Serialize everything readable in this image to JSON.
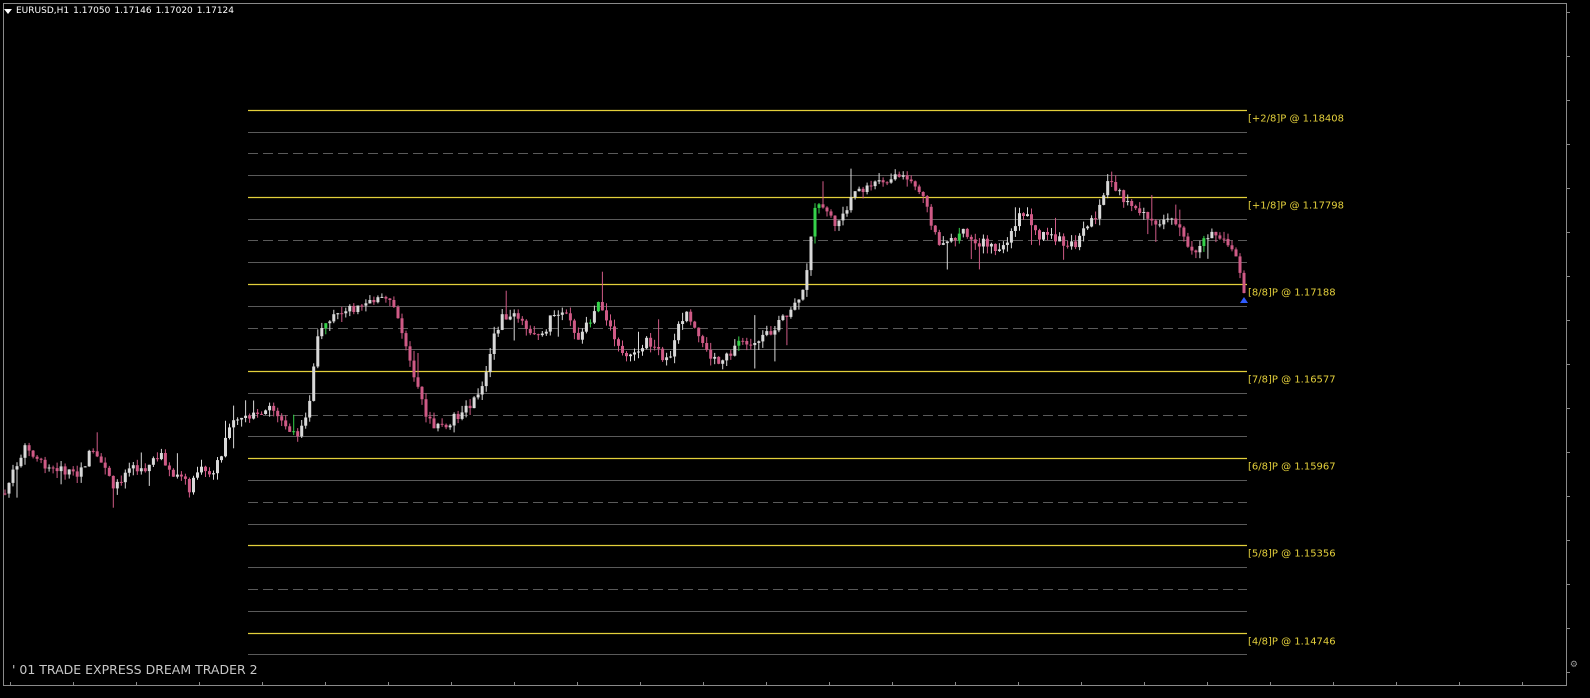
{
  "header": {
    "symbol": "EURUSD,H1",
    "open": "1.17050",
    "high": "1.17146",
    "low": "1.17020",
    "close": "1.17124"
  },
  "indicator_name": "' 01 TRADE EXPRESS DREAM TRADER 2",
  "colors": {
    "background": "#000000",
    "level_major": "#e3cf3b",
    "level_minor": "#5a5a5a",
    "candle_up": "#d9d9d9",
    "candle_down": "#cf5a86",
    "candle_green": "#35d24a",
    "frame": "#8a8a8a"
  },
  "chart_data": {
    "type": "candlestick",
    "symbol": "EURUSD",
    "timeframe": "H1",
    "price_range": [
      1.144,
      1.1905
    ],
    "murrey_levels": [
      {
        "label": "[+2/8]P @ 1.18408",
        "price": 1.18408,
        "kind": "major"
      },
      {
        "price": 1.18255,
        "kind": "minor",
        "style": "solid"
      },
      {
        "price": 1.18103,
        "kind": "minor",
        "style": "dashed"
      },
      {
        "price": 1.1795,
        "kind": "minor",
        "style": "solid"
      },
      {
        "label": "[+1/8]P @ 1.17798",
        "price": 1.17798,
        "kind": "major"
      },
      {
        "price": 1.17645,
        "kind": "minor",
        "style": "solid"
      },
      {
        "price": 1.17493,
        "kind": "minor",
        "style": "dashed"
      },
      {
        "price": 1.1734,
        "kind": "minor",
        "style": "solid"
      },
      {
        "label": "[8/8]P @ 1.17188",
        "price": 1.17188,
        "kind": "major"
      },
      {
        "price": 1.17035,
        "kind": "minor",
        "style": "solid"
      },
      {
        "price": 1.16882,
        "kind": "minor",
        "style": "dashed"
      },
      {
        "price": 1.1673,
        "kind": "minor",
        "style": "solid"
      },
      {
        "label": "[7/8]P @ 1.16577",
        "price": 1.16577,
        "kind": "major"
      },
      {
        "price": 1.16425,
        "kind": "minor",
        "style": "solid"
      },
      {
        "price": 1.16272,
        "kind": "minor",
        "style": "dashed"
      },
      {
        "price": 1.1612,
        "kind": "minor",
        "style": "solid"
      },
      {
        "label": "[6/8]P @ 1.15967",
        "price": 1.15967,
        "kind": "major"
      },
      {
        "price": 1.15814,
        "kind": "minor",
        "style": "solid"
      },
      {
        "price": 1.15662,
        "kind": "minor",
        "style": "dashed"
      },
      {
        "price": 1.15509,
        "kind": "minor",
        "style": "solid"
      },
      {
        "label": "[5/8]P @ 1.15356",
        "price": 1.15356,
        "kind": "major"
      },
      {
        "price": 1.15204,
        "kind": "minor",
        "style": "solid"
      },
      {
        "price": 1.15051,
        "kind": "minor",
        "style": "dashed"
      },
      {
        "price": 1.14899,
        "kind": "minor",
        "style": "solid"
      },
      {
        "label": "[4/8]P @ 1.14746",
        "price": 1.14746,
        "kind": "major"
      },
      {
        "price": 1.14593,
        "kind": "minor",
        "style": "solid"
      }
    ],
    "close_path": [
      1.1572,
      1.159,
      1.1605,
      1.1598,
      1.1593,
      1.159,
      1.1588,
      1.1584,
      1.159,
      1.1605,
      1.1595,
      1.1578,
      1.1583,
      1.159,
      1.1587,
      1.1595,
      1.1598,
      1.1585,
      1.1583,
      1.1575,
      1.159,
      1.1585,
      1.1595,
      1.162,
      1.1628,
      1.1625,
      1.163,
      1.1632,
      1.1625,
      1.162,
      1.161,
      1.1625,
      1.1685,
      1.1695,
      1.1698,
      1.1701,
      1.17,
      1.1703,
      1.171,
      1.1712,
      1.1702,
      1.1675,
      1.165,
      1.163,
      1.162,
      1.162,
      1.1625,
      1.163,
      1.1635,
      1.165,
      1.168,
      1.1695,
      1.1698,
      1.1695,
      1.1685,
      1.168,
      1.1695,
      1.1702,
      1.169,
      1.168,
      1.1695,
      1.1705,
      1.169,
      1.167,
      1.1665,
      1.1675,
      1.168,
      1.167,
      1.1665,
      1.169,
      1.17,
      1.1685,
      1.167,
      1.1665,
      1.167,
      1.1675,
      1.1678,
      1.168,
      1.1682,
      1.169,
      1.1695,
      1.1705,
      1.172,
      1.177,
      1.1775,
      1.176,
      1.177,
      1.178,
      1.1785,
      1.1788,
      1.179,
      1.1792,
      1.1795,
      1.179,
      1.178,
      1.176,
      1.1745,
      1.175,
      1.1755,
      1.175,
      1.1748,
      1.1745,
      1.174,
      1.175,
      1.177,
      1.1765,
      1.175,
      1.1755,
      1.175,
      1.1745,
      1.1748,
      1.176,
      1.177,
      1.179,
      1.1785,
      1.1775,
      1.177,
      1.1765,
      1.1762,
      1.1765,
      1.1762,
      1.175,
      1.174,
      1.175,
      1.1755,
      1.175,
      1.1745,
      1.1713
    ],
    "last_price": 1.17124
  }
}
